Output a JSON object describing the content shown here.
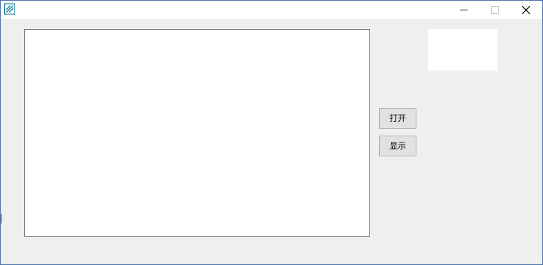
{
  "window": {
    "icon": "app-icon",
    "controls": {
      "minimize_icon": "minimize-icon",
      "maximize_icon": "maximize-icon",
      "close_icon": "close-icon"
    }
  },
  "main": {
    "text_area_value": "",
    "buttons": {
      "open_label": "打开",
      "show_label": "显示"
    }
  },
  "colors": {
    "client_background": "#efefef",
    "titlebar_background": "#ffffff",
    "button_background": "#e1e1e1",
    "app_icon_accent": "#1a7f9a"
  }
}
